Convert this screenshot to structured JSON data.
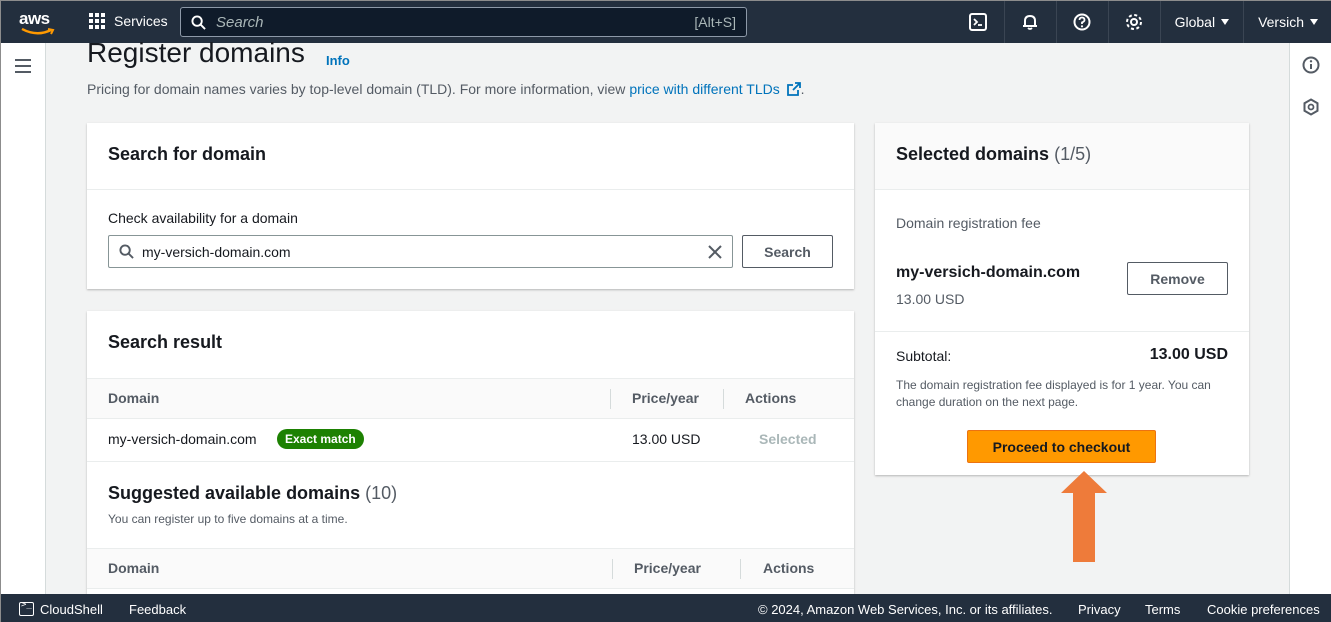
{
  "topnav": {
    "logo_text": "aws",
    "services_label": "Services",
    "search_placeholder": "Search",
    "search_shortcut": "[Alt+S]",
    "icons": [
      "cloudshell-icon",
      "bell-icon",
      "help-icon",
      "gear-icon"
    ],
    "region_label": "Global",
    "account_label": "Versich"
  },
  "header": {
    "title": "Register domains",
    "info_link": "Info",
    "description": "Pricing for domain names varies by top-level domain (TLD). For more information, view ",
    "price_link": "price with different TLDs",
    "description_end": "."
  },
  "search_panel": {
    "title": "Search for domain",
    "field_label": "Check availability for a domain",
    "input_value": "my-versich-domain.com",
    "search_button": "Search"
  },
  "search_result": {
    "title": "Search result",
    "columns": [
      "Domain",
      "Price/year",
      "Actions"
    ],
    "rows": [
      {
        "domain": "my-versich-domain.com",
        "badge": "Exact match",
        "price": "13.00 USD",
        "action": "Selected"
      }
    ]
  },
  "suggested": {
    "title": "Suggested available domains",
    "count": "(10)",
    "description": "You can register up to five domains at a time.",
    "columns": [
      "Domain",
      "Price/year",
      "Actions"
    ]
  },
  "selected_panel": {
    "title": "Selected domains",
    "count": "(1/5)",
    "fee_label": "Domain registration fee",
    "domain": "my-versich-domain.com",
    "price": "13.00 USD",
    "remove_button": "Remove",
    "subtotal_label": "Subtotal:",
    "subtotal_value": "13.00 USD",
    "fee_note": "The domain registration fee displayed is for 1 year. You can change duration on the next page.",
    "checkout_button": "Proceed to checkout"
  },
  "footer": {
    "cloudshell": "CloudShell",
    "feedback": "Feedback",
    "copyright": "© 2024, Amazon Web Services, Inc. or its affiliates.",
    "privacy": "Privacy",
    "terms": "Terms",
    "cookies": "Cookie preferences"
  },
  "colors": {
    "nav_bg": "#232f3e",
    "link": "#0073bb",
    "primary_button": "#ff9900",
    "badge_green": "#1d8102",
    "annotation_arrow": "#ee7b3a"
  }
}
